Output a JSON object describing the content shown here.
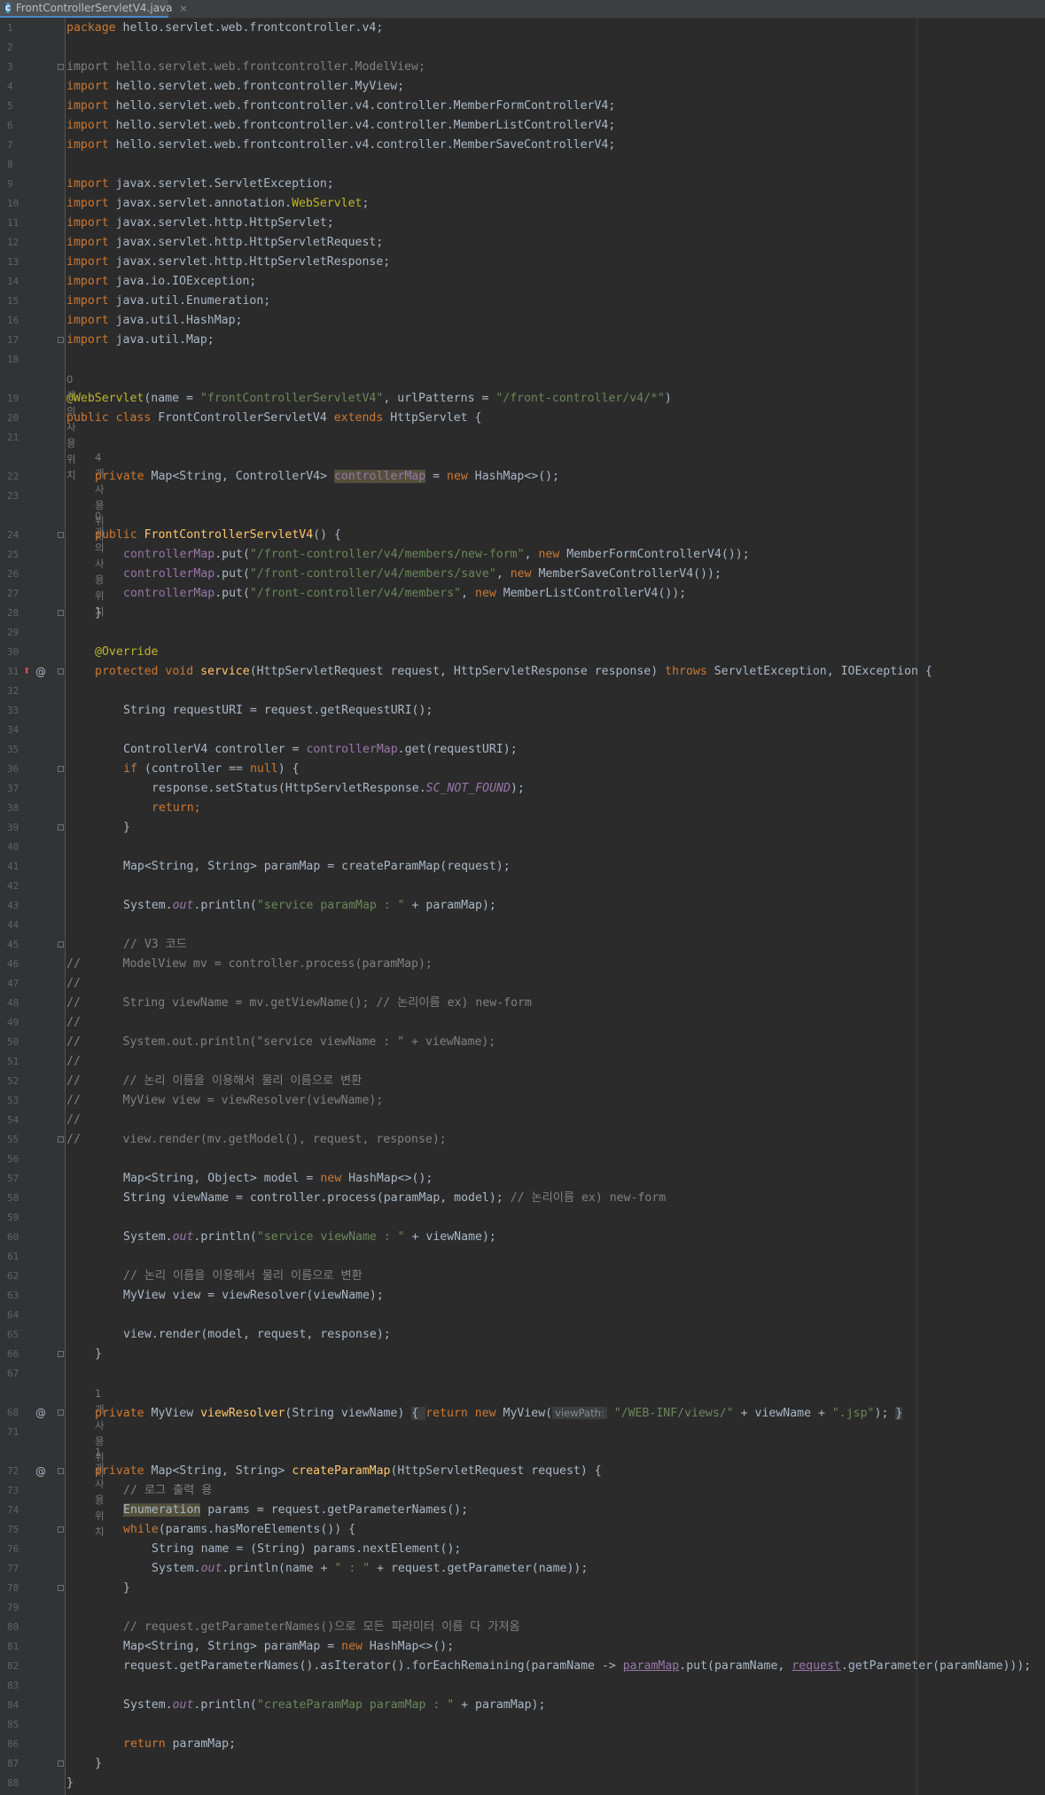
{
  "tab": {
    "title": "FrontControllerServletV4.java",
    "icon": "C",
    "close": "×"
  },
  "hints": {
    "h18": "0개의 사용위치",
    "h21": "4개 사용 위치",
    "h23": "0개의 사용위치",
    "h67": "1개 사용 위치",
    "h71": "1개 사용 위치"
  },
  "gutter_icons": {
    "override_arrow": "⬆",
    "at31": "@",
    "at68": "@",
    "at72": "@"
  },
  "inlay": {
    "viewPath": "viewPath:"
  },
  "code": {
    "l1a": "package",
    "l1b": " hello.servlet.web.frontcontroller.v4;",
    "l3a": "import hello.servlet.web.frontcontroller.ModelView;",
    "l4b": " hello.servlet.web.frontcontroller.MyView;",
    "l5b": " hello.servlet.web.frontcontroller.v4.controller.MemberFormControllerV4;",
    "l6b": " hello.servlet.web.frontcontroller.v4.controller.MemberListControllerV4;",
    "l7b": " hello.servlet.web.frontcontroller.v4.controller.MemberSaveControllerV4;",
    "l9b": " javax.servlet.ServletException;",
    "l10b": " javax.servlet.annotation.",
    "l10c": "WebServlet",
    "l11b": " javax.servlet.http.HttpServlet;",
    "l12b": " javax.servlet.http.HttpServletRequest;",
    "l13b": " javax.servlet.http.HttpServletResponse;",
    "l14b": " java.io.IOException;",
    "l15b": " java.util.Enumeration;",
    "l16b": " java.util.HashMap;",
    "l17b": " java.util.Map;",
    "import": "import",
    "l19a": "@WebServlet",
    "l19b": "(name = ",
    "l19c": "\"frontControllerServletV4\"",
    "l19d": ", urlPatterns = ",
    "l19e": "\"/front-controller/v4/*\"",
    "l19f": ")",
    "l20a": "public class",
    "l20b": " FrontControllerServletV4 ",
    "l20c": "extends",
    "l20d": " HttpServlet {",
    "l22a": "private",
    "l22b": " Map<String, ControllerV4> ",
    "l22c": "controllerMap",
    "l22d": " = ",
    "l22e": "new",
    "l22f": " HashMap<>();",
    "l24a": "public",
    "l24b": "FrontControllerServletV4",
    "l24c": "() {",
    "l25b": ".put(",
    "l25c": "\"/front-controller/v4/members/new-form\"",
    "l25d": ", ",
    "l25e": "new",
    "l25f": " MemberFormControllerV4());",
    "l26c": "\"/front-controller/v4/members/save\"",
    "l26f": " MemberSaveControllerV4());",
    "l27c": "\"/front-controller/v4/members\"",
    "l27f": " MemberListControllerV4());",
    "cmap": "controllerMap",
    "l28": "}",
    "l30": "@Override",
    "l31a": "protected void",
    "l31b": "service",
    "l31c": "(HttpServletRequest request, HttpServletResponse response) ",
    "l31d": "throws",
    "l31e": " ServletException, IOException {",
    "l33": "String requestURI = request.getRequestURI();",
    "l35a": "ControllerV4 controller = ",
    "l35b": "controllerMap",
    "l35c": ".get(requestURI);",
    "l36a": "if",
    "l36b": " (controller == ",
    "l36c": "null",
    "l36d": ") {",
    "l37a": "response.setStatus(HttpServletResponse.",
    "l37b": "SC_NOT_FOUND",
    "l37c": ");",
    "l38": "return;",
    "l39": "}",
    "l41": "Map<String, String> paramMap = createParamMap(request);",
    "l43a": "System.",
    "l43b": "out",
    "l43c": ".println(",
    "l43d": "\"service paramMap : \"",
    "l43e": " + paramMap);",
    "l45": "// V3 코드",
    "l46": "//      ModelView mv = controller.process(paramMap);",
    "l47": "//",
    "l48": "//      String viewName = mv.getViewName(); // 논리이름 ex) new-form",
    "l50": "//      System.out.println(\"service viewName : \" + viewName);",
    "l52": "//      // 논리 이름을 이용해서 물리 이름으로 변환",
    "l53": "//      MyView view = viewResolver(viewName);",
    "l55": "//      view.render(mv.getModel(), request, response);",
    "l57a": "Map<String, Object> model = ",
    "l57b": "new",
    "l57c": " HashMap<>();",
    "l58a": "String viewName = controller.process(paramMap, model); ",
    "l58b": "// 논리이름 ex) new-form",
    "l60d": "\"service viewName : \"",
    "l60e": " + viewName);",
    "l62": "// 논리 이름을 이용해서 물리 이름으로 변환",
    "l63": "MyView view = viewResolver(viewName);",
    "l65": "view.render(model, request, response);",
    "l66": "}",
    "l68a": "private",
    "l68b": " MyView ",
    "l68c": "viewResolver",
    "l68d": "(String viewName) ",
    "l68e": "{ ",
    "l68f": "return new",
    "l68g": " MyView(",
    "l68h": "\"/WEB-INF/views/\"",
    "l68i": " + viewName + ",
    "l68j": "\".jsp\"",
    "l68k": "); ",
    "l68l": "}",
    "l72a": "private",
    "l72b": " Map<String, String> ",
    "l72c": "createParamMap",
    "l72d": "(HttpServletRequest request) {",
    "l73": "// 로그 출력 용",
    "l74a": "Enumeration",
    "l74b": " params = request.getParameterNames();",
    "l75a": "while",
    "l75b": "(params.hasMoreElements()) {",
    "l76": "String name = (String) params.nextElement();",
    "l77e": "(name + ",
    "l77f": "\" : \"",
    "l77g": " + request.getParameter(name));",
    "l78": "}",
    "l80": "// request.getParameterNames()으로 모든 파라미터 이름 다 가져옴",
    "l81a": "Map<String, String> paramMap = ",
    "l81b": "new",
    "l81c": " HashMap<>();",
    "l82a": "request.getParameterNames().asIterator().forEachRemaining(paramName -> ",
    "l82b": "paramMap",
    "l82c": ".put(paramName, ",
    "l82d": "request",
    "l82e": ".getParameter(paramName)));",
    "l84d": "\"createParamMap paramMap : \"",
    "l84e": " + paramMap);",
    "l86a": "return",
    "l86b": " paramMap;",
    "l87": "}",
    "l88": "}"
  },
  "line_numbers": [
    "1",
    "2",
    "3",
    "4",
    "5",
    "6",
    "7",
    "8",
    "9",
    "10",
    "11",
    "12",
    "13",
    "14",
    "15",
    "16",
    "17",
    "18",
    "19",
    "20",
    "21",
    "22",
    "23",
    "24",
    "25",
    "26",
    "27",
    "28",
    "29",
    "30",
    "31",
    "32",
    "33",
    "34",
    "35",
    "36",
    "37",
    "38",
    "39",
    "40",
    "41",
    "42",
    "43",
    "44",
    "45",
    "46",
    "47",
    "48",
    "49",
    "50",
    "51",
    "52",
    "53",
    "54",
    "55",
    "56",
    "57",
    "58",
    "59",
    "60",
    "61",
    "62",
    "63",
    "64",
    "65",
    "66",
    "67",
    "68",
    "71",
    "72",
    "73",
    "74",
    "75",
    "76",
    "77",
    "78",
    "79",
    "80",
    "81",
    "82",
    "83",
    "84",
    "85",
    "86",
    "87",
    "88"
  ]
}
